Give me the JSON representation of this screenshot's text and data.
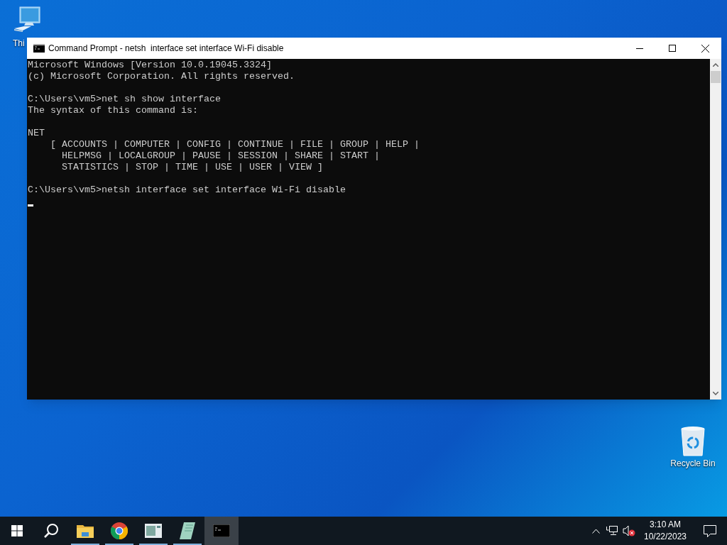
{
  "desktop_icons": [
    {
      "kind": "computer",
      "label": "Thi"
    },
    {
      "kind": "recycle-bin",
      "label": "Recycle Bin"
    }
  ],
  "window": {
    "title": "Command Prompt - netsh  interface set interface Wi-Fi disable",
    "console": {
      "blocks": [
        [
          "Microsoft Windows [Version 10.0.19045.3324]",
          "(c) Microsoft Corporation. All rights reserved."
        ],
        [
          "C:\\Users\\vm5>net sh show interface",
          "The syntax of this command is:"
        ],
        [
          "NET",
          "    [ ACCOUNTS | COMPUTER | CONFIG | CONTINUE | FILE | GROUP | HELP |",
          "      HELPMSG | LOCALGROUP | PAUSE | SESSION | SHARE | START |",
          "      STATISTICS | STOP | TIME | USE | USER | VIEW ]"
        ],
        [
          "C:\\Users\\vm5>netsh interface set interface Wi-Fi disable"
        ]
      ],
      "cursor": true
    }
  },
  "taskbar": {
    "apps": [
      {
        "kind": "folder",
        "running": true,
        "active": false
      },
      {
        "kind": "browser",
        "running": true,
        "active": false
      },
      {
        "kind": "window",
        "running": true,
        "active": false
      },
      {
        "kind": "notepad",
        "running": true,
        "active": false
      },
      {
        "kind": "terminal",
        "running": false,
        "active": true
      }
    ],
    "time": "3:10 AM",
    "date": "10/22/2023",
    "sound_muted": true
  }
}
